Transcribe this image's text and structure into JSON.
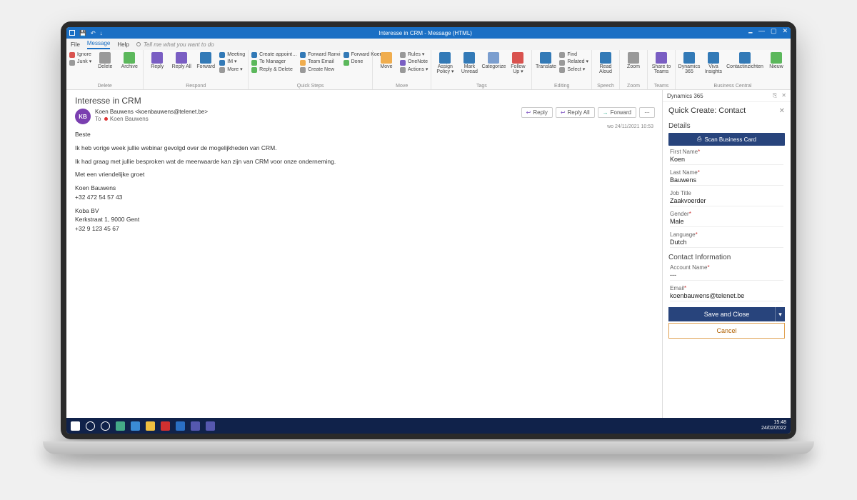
{
  "titlebar": {
    "title": "Interesse in CRM - Message (HTML)"
  },
  "tabs": {
    "file": "File",
    "message": "Message",
    "help": "Help",
    "search": "Tell me what you want to do"
  },
  "ribbon": {
    "delete": {
      "ignore": "Ignore",
      "junk": "Junk ▾",
      "delete": "Delete",
      "archive": "Archive",
      "label": "Delete"
    },
    "respond": {
      "reply": "Reply",
      "replyall": "Reply\nAll",
      "forward": "Forward",
      "meeting": "Meeting",
      "im": "IM ▾",
      "more": "More ▾",
      "label": "Respond"
    },
    "quicksteps": {
      "a1": "Create appoint…",
      "a2": "Forward Ranvi",
      "a3": "Forward Koenva",
      "b1": "To Manager",
      "b2": "Team Email",
      "b3": "Done",
      "c1": "Reply & Delete",
      "c2": "Create New",
      "label": "Quick Steps"
    },
    "move": {
      "move": "Move",
      "rules": "Rules ▾",
      "onenote": "OneNote",
      "actions": "Actions ▾",
      "label": "Move"
    },
    "tags": {
      "assign": "Assign\nPolicy ▾",
      "mark": "Mark\nUnread",
      "categorize": "Categorize",
      "followup": "Follow\nUp ▾",
      "label": "Tags"
    },
    "editing": {
      "translate": "Translate",
      "find": "Find",
      "related": "Related ▾",
      "select": "Select ▾",
      "label": "Editing"
    },
    "speech": {
      "read": "Read\nAloud",
      "label": "Speech"
    },
    "zoom": {
      "zoom": "Zoom",
      "label": "Zoom"
    },
    "teams": {
      "share": "Share to\nTeams",
      "label": "Teams"
    },
    "bc": {
      "d365": "Dynamics\n365",
      "viva": "Viva\nInsights",
      "contact": "Contactinzichten",
      "new": "Nieuw",
      "label": "Business Central"
    }
  },
  "message": {
    "subject": "Interesse in CRM",
    "avatar": "KB",
    "from": "Koen Bauwens <koenbauwens@telenet.be>",
    "to_label": "To",
    "to_name": "Koen Bauwens",
    "actions": {
      "reply": "Reply",
      "replyall": "Reply All",
      "forward": "Forward"
    },
    "date": "wo 24/11/2021 10:53",
    "body": {
      "l1": "Beste",
      "l2": "Ik heb vorige week jullie webinar gevolgd over de mogelijkheden van CRM.",
      "l3": "Ik had graag met jullie besproken wat de meerwaarde kan zijn van CRM voor onze onderneming.",
      "l4": "Met een vriendelijke groet",
      "sig1": "Koen Bauwens",
      "sig2": "+32 472 54 57 43",
      "sig3": "Koba BV",
      "sig4": "Kerkstraat 1, 9000 Gent",
      "sig5": "+32 9 123 45 67"
    }
  },
  "d365": {
    "pane_title": "Dynamics 365",
    "header": "Quick Create: Contact",
    "details": "Details",
    "scan": "Scan Business Card",
    "contact_info": "Contact Information",
    "fields": {
      "first_name_l": "First Name",
      "first_name_v": "Koen",
      "last_name_l": "Last Name",
      "last_name_v": "Bauwens",
      "job_title_l": "Job Title",
      "job_title_v": "Zaakvoerder",
      "gender_l": "Gender",
      "gender_v": "Male",
      "language_l": "Language",
      "language_v": "Dutch",
      "account_l": "Account Name",
      "account_v": "---",
      "email_l": "Email",
      "email_v": "koenbauwens@telenet.be"
    },
    "save": "Save and Close",
    "cancel": "Cancel"
  },
  "taskbar": {
    "time": "15:48",
    "date": "24/02/2022"
  }
}
